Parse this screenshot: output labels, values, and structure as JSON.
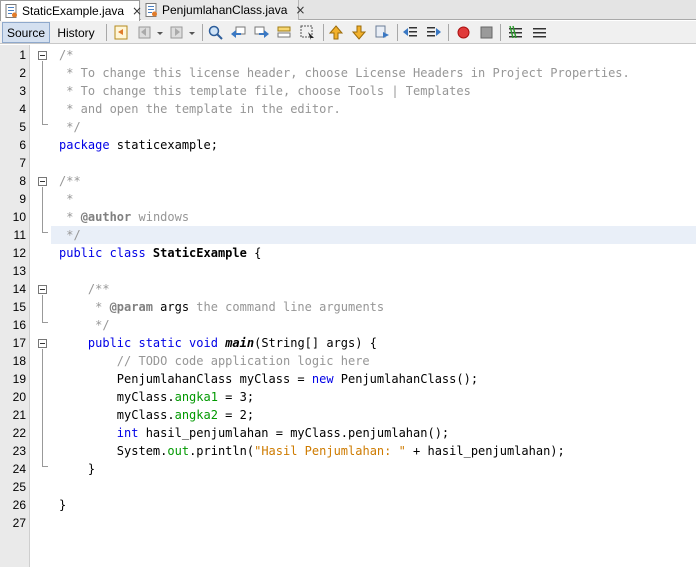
{
  "tabs": [
    {
      "label": "StaticExample.java",
      "active": true
    },
    {
      "label": "PenjumlahanClass.java",
      "active": false
    }
  ],
  "close_glyph": "×",
  "toolbar": {
    "source_label": "Source",
    "history_label": "History"
  },
  "editor": {
    "line_numbers": [
      "1",
      "2",
      "3",
      "4",
      "5",
      "6",
      "7",
      "8",
      "9",
      "10",
      "11",
      "12",
      "13",
      "14",
      "15",
      "16",
      "17",
      "18",
      "19",
      "20",
      "21",
      "22",
      "23",
      "24",
      "25",
      "26",
      "27"
    ],
    "lines": {
      "l1": "/*",
      "l2": " * To change this license header, choose License Headers in Project Properties.",
      "l3": " * To change this template file, choose Tools | Templates",
      "l4": " * and open the template in the editor.",
      "l5": " */",
      "l6_kw": "package",
      "l6_rest": " staticexample;",
      "l8": "/**",
      "l9": " *",
      "l10_a": " * ",
      "l10_tag": "@author",
      "l10_b": " windows",
      "l11": " */",
      "l12_kw": "public class",
      "l12_name": " StaticExample",
      "l12_rest": " {",
      "l14": "    /**",
      "l15_a": "     * ",
      "l15_tag": "@param",
      "l15_arg": " args",
      "l15_b": " the command line arguments",
      "l16": "     */",
      "l17_ind": "    ",
      "l17_kw": "public static void",
      "l17_sp": " ",
      "l17_name": "main",
      "l17_rest": "(String[] args) {",
      "l18": "        // TODO code application logic here",
      "l19_a": "        PenjumlahanClass myClass = ",
      "l19_kw": "new",
      "l19_b": " PenjumlahanClass();",
      "l20_a": "        myClass.",
      "l20_f": "angka1",
      "l20_b": " = 3;",
      "l21_a": "        myClass.",
      "l21_f": "angka2",
      "l21_b": " = 2;",
      "l22_ind": "        ",
      "l22_kw": "int",
      "l22_b": " hasil_penjumlahan = myClass.penjumlahan();",
      "l23_a": "        System.",
      "l23_f": "out",
      "l23_b": ".println(",
      "l23_s": "\"Hasil Penjumlahan: \"",
      "l23_c": " + hasil_penjumlahan);",
      "l24": "    }",
      "l26": "}"
    }
  }
}
